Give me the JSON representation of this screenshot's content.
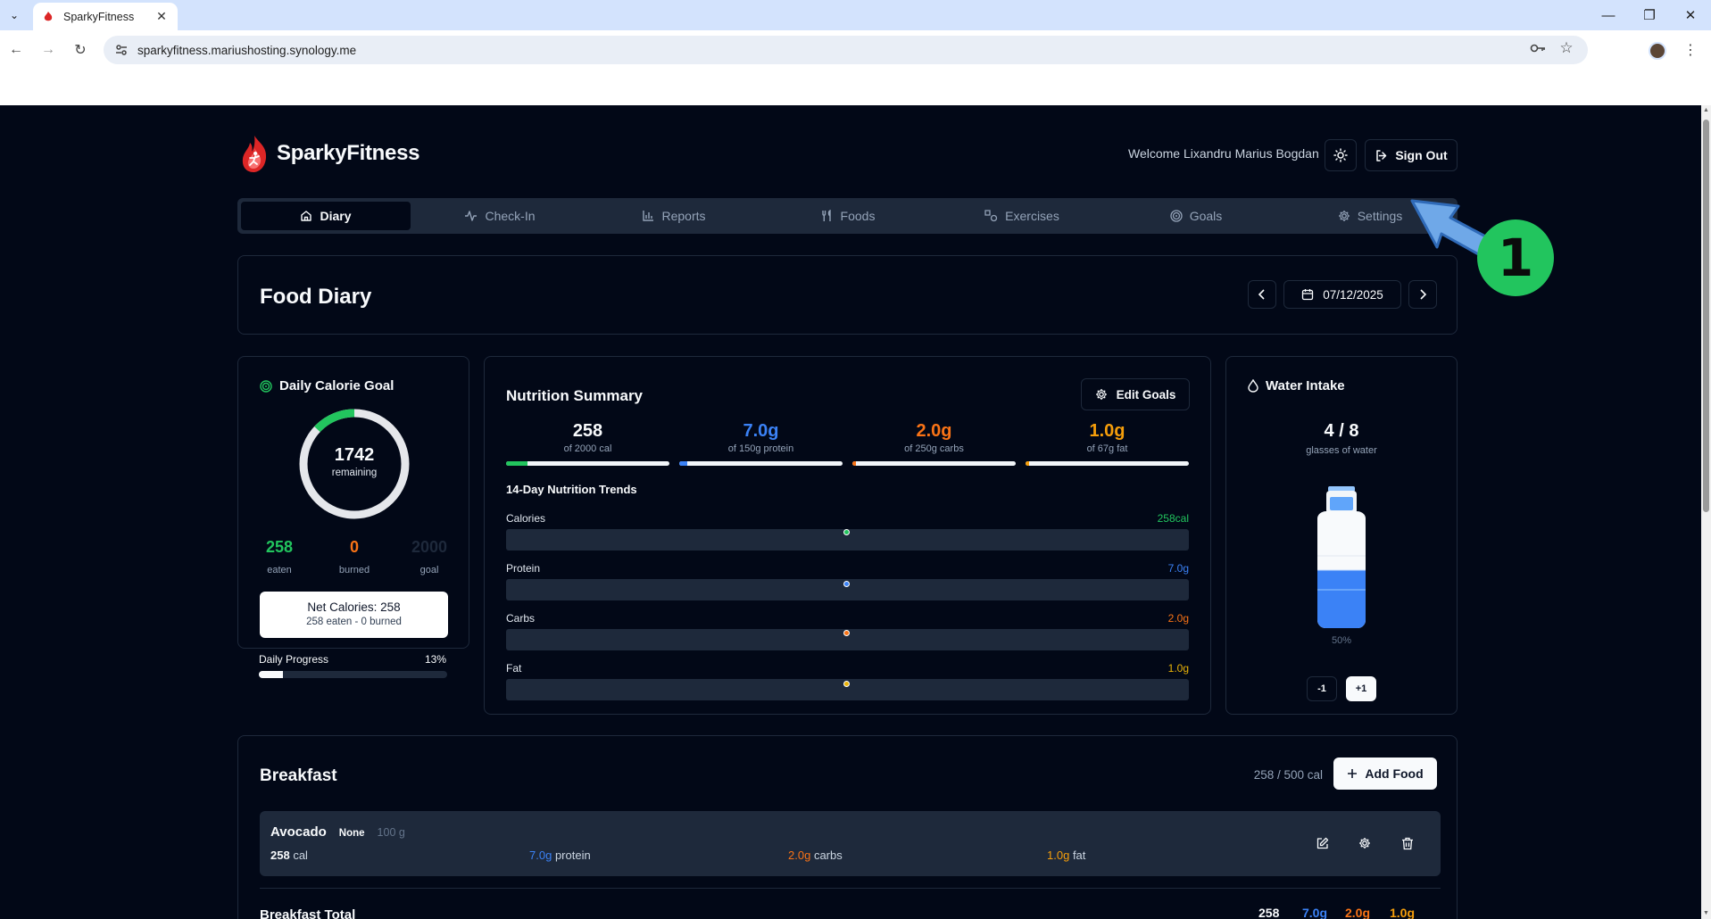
{
  "browser": {
    "tab_title": "SparkyFitness",
    "url": "sparkyfitness.mariushosting.synology.me"
  },
  "app": {
    "brand": "SparkyFitness",
    "welcome": "Welcome Lixandru Marius Bogdan",
    "sign_out": "Sign Out",
    "nav": [
      {
        "label": "Diary",
        "icon": "home-icon",
        "active": true
      },
      {
        "label": "Check-In",
        "icon": "activity-icon"
      },
      {
        "label": "Reports",
        "icon": "bar-chart-icon"
      },
      {
        "label": "Foods",
        "icon": "utensils-icon"
      },
      {
        "label": "Exercises",
        "icon": "shapes-icon"
      },
      {
        "label": "Goals",
        "icon": "target-icon"
      },
      {
        "label": "Settings",
        "icon": "gear-icon"
      }
    ]
  },
  "food_diary": {
    "title": "Food Diary",
    "date": "07/12/2025"
  },
  "calorie_goal": {
    "title": "Daily Calorie Goal",
    "remaining_value": "1742",
    "remaining_label": "remaining",
    "ring_progress": 0.13,
    "eaten_value": "258",
    "eaten_label": "eaten",
    "burned_value": "0",
    "burned_label": "burned",
    "goal_value": "2000",
    "goal_label": "goal",
    "net_title": "Net Calories: 258",
    "net_sub": "258 eaten - 0 burned",
    "progress_label": "Daily Progress",
    "progress_pct": "13%",
    "progress_fraction": 0.13
  },
  "nutrition_summary": {
    "title": "Nutrition Summary",
    "edit_goals": "Edit Goals",
    "stats": [
      {
        "value": "258",
        "label": "of 2000 cal",
        "color": "#f8fafc",
        "bar_color": "#22c55e",
        "fraction": 0.13
      },
      {
        "value": "7.0g",
        "label": "of 150g protein",
        "color": "#3b82f6",
        "bar_color": "#3b82f6",
        "fraction": 0.05
      },
      {
        "value": "2.0g",
        "label": "of 250g carbs",
        "color": "#f97316",
        "bar_color": "#f97316",
        "fraction": 0.01
      },
      {
        "value": "1.0g",
        "label": "of 67g fat",
        "color": "#f59e0b",
        "bar_color": "#f59e0b",
        "fraction": 0.015
      }
    ],
    "trends_title": "14-Day Nutrition Trends",
    "trends": [
      {
        "label": "Calories",
        "value": "258cal",
        "color": "#22c55e"
      },
      {
        "label": "Protein",
        "value": "7.0g",
        "color": "#3b82f6"
      },
      {
        "label": "Carbs",
        "value": "2.0g",
        "color": "#f97316"
      },
      {
        "label": "Fat",
        "value": "1.0g",
        "color": "#eab308"
      }
    ]
  },
  "water": {
    "title": "Water Intake",
    "value": "4 / 8",
    "label": "glasses of water",
    "fill_pct": "50%",
    "minus": "-1",
    "plus": "+1"
  },
  "breakfast": {
    "title": "Breakfast",
    "cal_summary": "258 / 500 cal",
    "add_food": "Add Food",
    "item": {
      "name": "Avocado",
      "brand": "None",
      "qty": "100 g",
      "cal_value": "258",
      "cal_unit": "cal",
      "protein_value": "7.0g",
      "protein_unit": "protein",
      "carbs_value": "2.0g",
      "carbs_unit": "carbs",
      "fat_value": "1.0g",
      "fat_unit": "fat"
    },
    "total_label": "Breakfast Total",
    "totals": {
      "cal": "258",
      "protein": "7.0g",
      "carbs": "2.0g",
      "fat": "1.0g"
    }
  },
  "annotation": {
    "step": "1",
    "arrow_color": "#6fa8e8",
    "badge_color": "#22c55e"
  }
}
